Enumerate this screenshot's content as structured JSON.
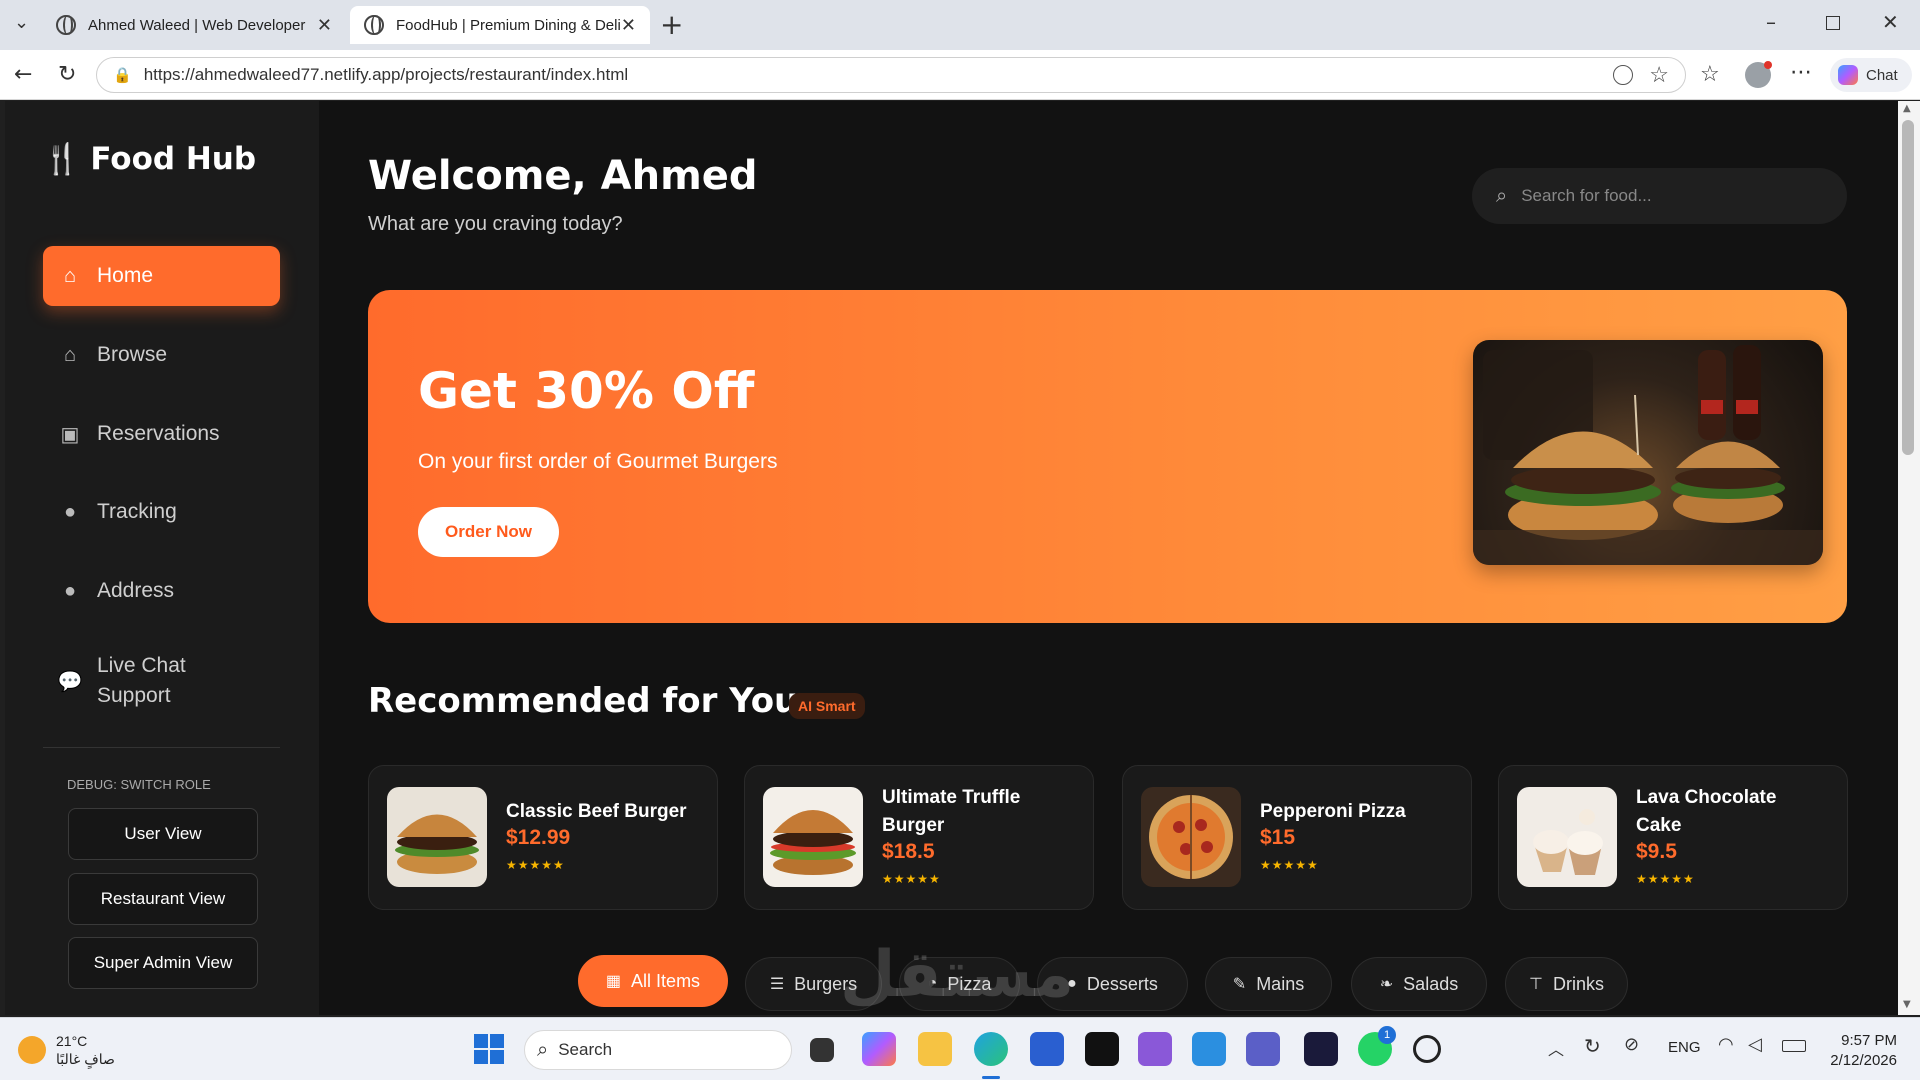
{
  "browser": {
    "tabs": [
      {
        "title": "Ahmed Waleed | Web Developer"
      },
      {
        "title": "FoodHub | Premium Dining & Deli"
      }
    ],
    "url": "https://ahmedwaleed77.netlify.app/projects/restaurant/index.html",
    "chat_label": "Chat"
  },
  "sidebar": {
    "brand": "Food Hub",
    "items": [
      {
        "label": "Home",
        "icon": "home-icon",
        "active": true
      },
      {
        "label": "Browse",
        "icon": "home-icon"
      },
      {
        "label": "Reservations",
        "icon": "calendar-icon"
      },
      {
        "label": "Tracking",
        "icon": "map-pin-icon"
      },
      {
        "label": "Address",
        "icon": "map-pin-icon"
      },
      {
        "label": "Live Chat",
        "label2": "Support",
        "icon": "chat-icon"
      }
    ],
    "debug_label": "DEBUG: SWITCH ROLE",
    "roles": [
      "User View",
      "Restaurant View",
      "Super Admin View"
    ]
  },
  "header": {
    "welcome": "Welcome, Ahmed",
    "subtitle": "What are you craving today?",
    "search_placeholder": "Search for food..."
  },
  "banner": {
    "title": "Get 30% Off",
    "text": "On your first order of Gourmet Burgers",
    "button": "Order Now"
  },
  "recommended": {
    "title": "Recommended for You",
    "badge": "AI Smart",
    "items": [
      {
        "name": "Classic Beef Burger",
        "price": "$12.99",
        "stars": "★★★★★",
        "rating": 5
      },
      {
        "name": "Ultimate Truffle",
        "name2": "Burger",
        "price": "$18.5",
        "stars": "★★★★★",
        "rating": 5
      },
      {
        "name": "Pepperoni Pizza",
        "price": "$15",
        "stars": "★★★★★",
        "rating": 5
      },
      {
        "name": "Lava Chocolate",
        "name2": "Cake",
        "price": "$9.5",
        "stars": "★★★★★",
        "rating": 5
      }
    ]
  },
  "categories": [
    {
      "label": "All Items",
      "icon": "grid-icon",
      "active": true
    },
    {
      "label": "Burgers",
      "icon": "burger-icon"
    },
    {
      "label": "Pizza",
      "icon": "pizza-icon"
    },
    {
      "label": "Desserts",
      "icon": "cookie-icon"
    },
    {
      "label": "Mains",
      "icon": "drumstick-icon"
    },
    {
      "label": "Salads",
      "icon": "leaf-icon"
    },
    {
      "label": "Drinks",
      "icon": "glass-icon"
    }
  ],
  "taskbar": {
    "temp": "21°C",
    "condition": "صافٍ غالبًا",
    "search": "Search",
    "lang": "ENG",
    "time": "9:57 PM",
    "date": "2/12/2026",
    "badge": "1"
  },
  "watermark": "مستقل",
  "colors": {
    "accent": "#ff6b2c",
    "bg": "#121212",
    "sidebar": "#1b1b1b",
    "star": "#f7b500"
  }
}
